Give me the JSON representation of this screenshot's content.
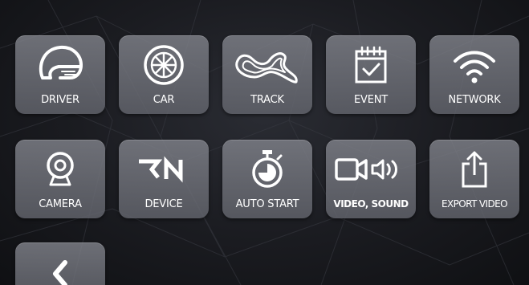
{
  "menu": {
    "row1": [
      {
        "label": "DRIVER",
        "icon": "helmet-icon"
      },
      {
        "label": "CAR",
        "icon": "wheel-icon"
      },
      {
        "label": "TRACK",
        "icon": "track-icon"
      },
      {
        "label": "EVENT",
        "icon": "calendar-check-icon"
      },
      {
        "label": "NETWORK",
        "icon": "wifi-icon"
      }
    ],
    "row2": [
      {
        "label": "CAMERA",
        "icon": "webcam-icon"
      },
      {
        "label": "DEVICE",
        "icon": "rn-logo-icon",
        "logo_text": "RN"
      },
      {
        "label": "AUTO START",
        "icon": "stopwatch-icon"
      },
      {
        "label": "VIDEO, SOUND",
        "icon": "video-sound-icon"
      },
      {
        "label": "EXPORT VIDEO",
        "icon": "export-icon"
      }
    ],
    "back": {
      "icon": "chevron-left-icon"
    }
  },
  "colors": {
    "tile": "#72747c",
    "text": "#ffffff",
    "background": "#1b1c21"
  }
}
